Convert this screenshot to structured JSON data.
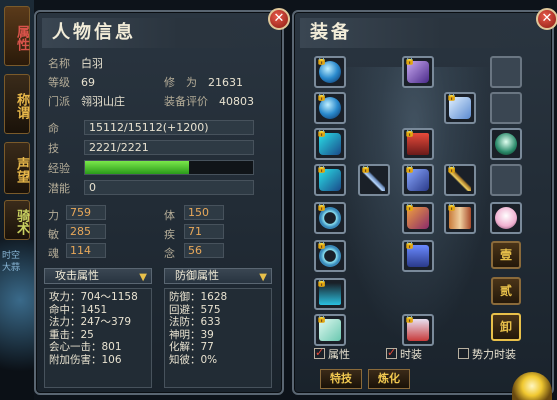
{
  "side_tabs": [
    "属性",
    "称谓",
    "声望",
    "骑术"
  ],
  "left_deco_text": "时空\n大蒜",
  "info": {
    "title": "人物信息",
    "name_label": "名称",
    "name": "白羽",
    "level_label": "等级",
    "level": "69",
    "cultivation_label": "修　为",
    "cultivation": "21631",
    "sect_label": "门派",
    "sect": "翎羽山庄",
    "rating_label": "装备评价",
    "rating": "40803",
    "hp_label": "命",
    "hp": "15112/15112(+1200)",
    "skill_label": "技",
    "skill": "2221/2221",
    "exp_label": "经验",
    "exp_fraction": 0.62,
    "potential_label": "潜能",
    "potential": "0",
    "stats": [
      {
        "label": "力",
        "value": "759"
      },
      {
        "label": "体",
        "value": "150"
      },
      {
        "label": "敏",
        "value": "285"
      },
      {
        "label": "疾",
        "value": "71"
      },
      {
        "label": "魂",
        "value": "114"
      },
      {
        "label": "念",
        "value": "56"
      }
    ],
    "attack_header": "攻击属性",
    "defense_header": "防御属性",
    "attack": [
      "攻力：704～1158",
      "命中：1451",
      "法力：247～379",
      "重击：25",
      "会心一击：801",
      "附加伤害：106"
    ],
    "defense": [
      "防御：1628",
      "回避：575",
      "法防：633",
      "神明：39",
      "化解：77",
      "知彼：0%"
    ]
  },
  "equip": {
    "title": "装备",
    "side_buttons": [
      "壹",
      "贰",
      "卸"
    ],
    "checks": [
      {
        "label": "属性",
        "checked": true
      },
      {
        "label": "时装",
        "checked": true
      },
      {
        "label": "势力时装",
        "checked": false
      }
    ],
    "buttons": [
      "特技",
      "炼化"
    ]
  },
  "colors": {
    "accent": "#e8c04a",
    "exp": "#4ac82a",
    "close": "#d8382a"
  }
}
